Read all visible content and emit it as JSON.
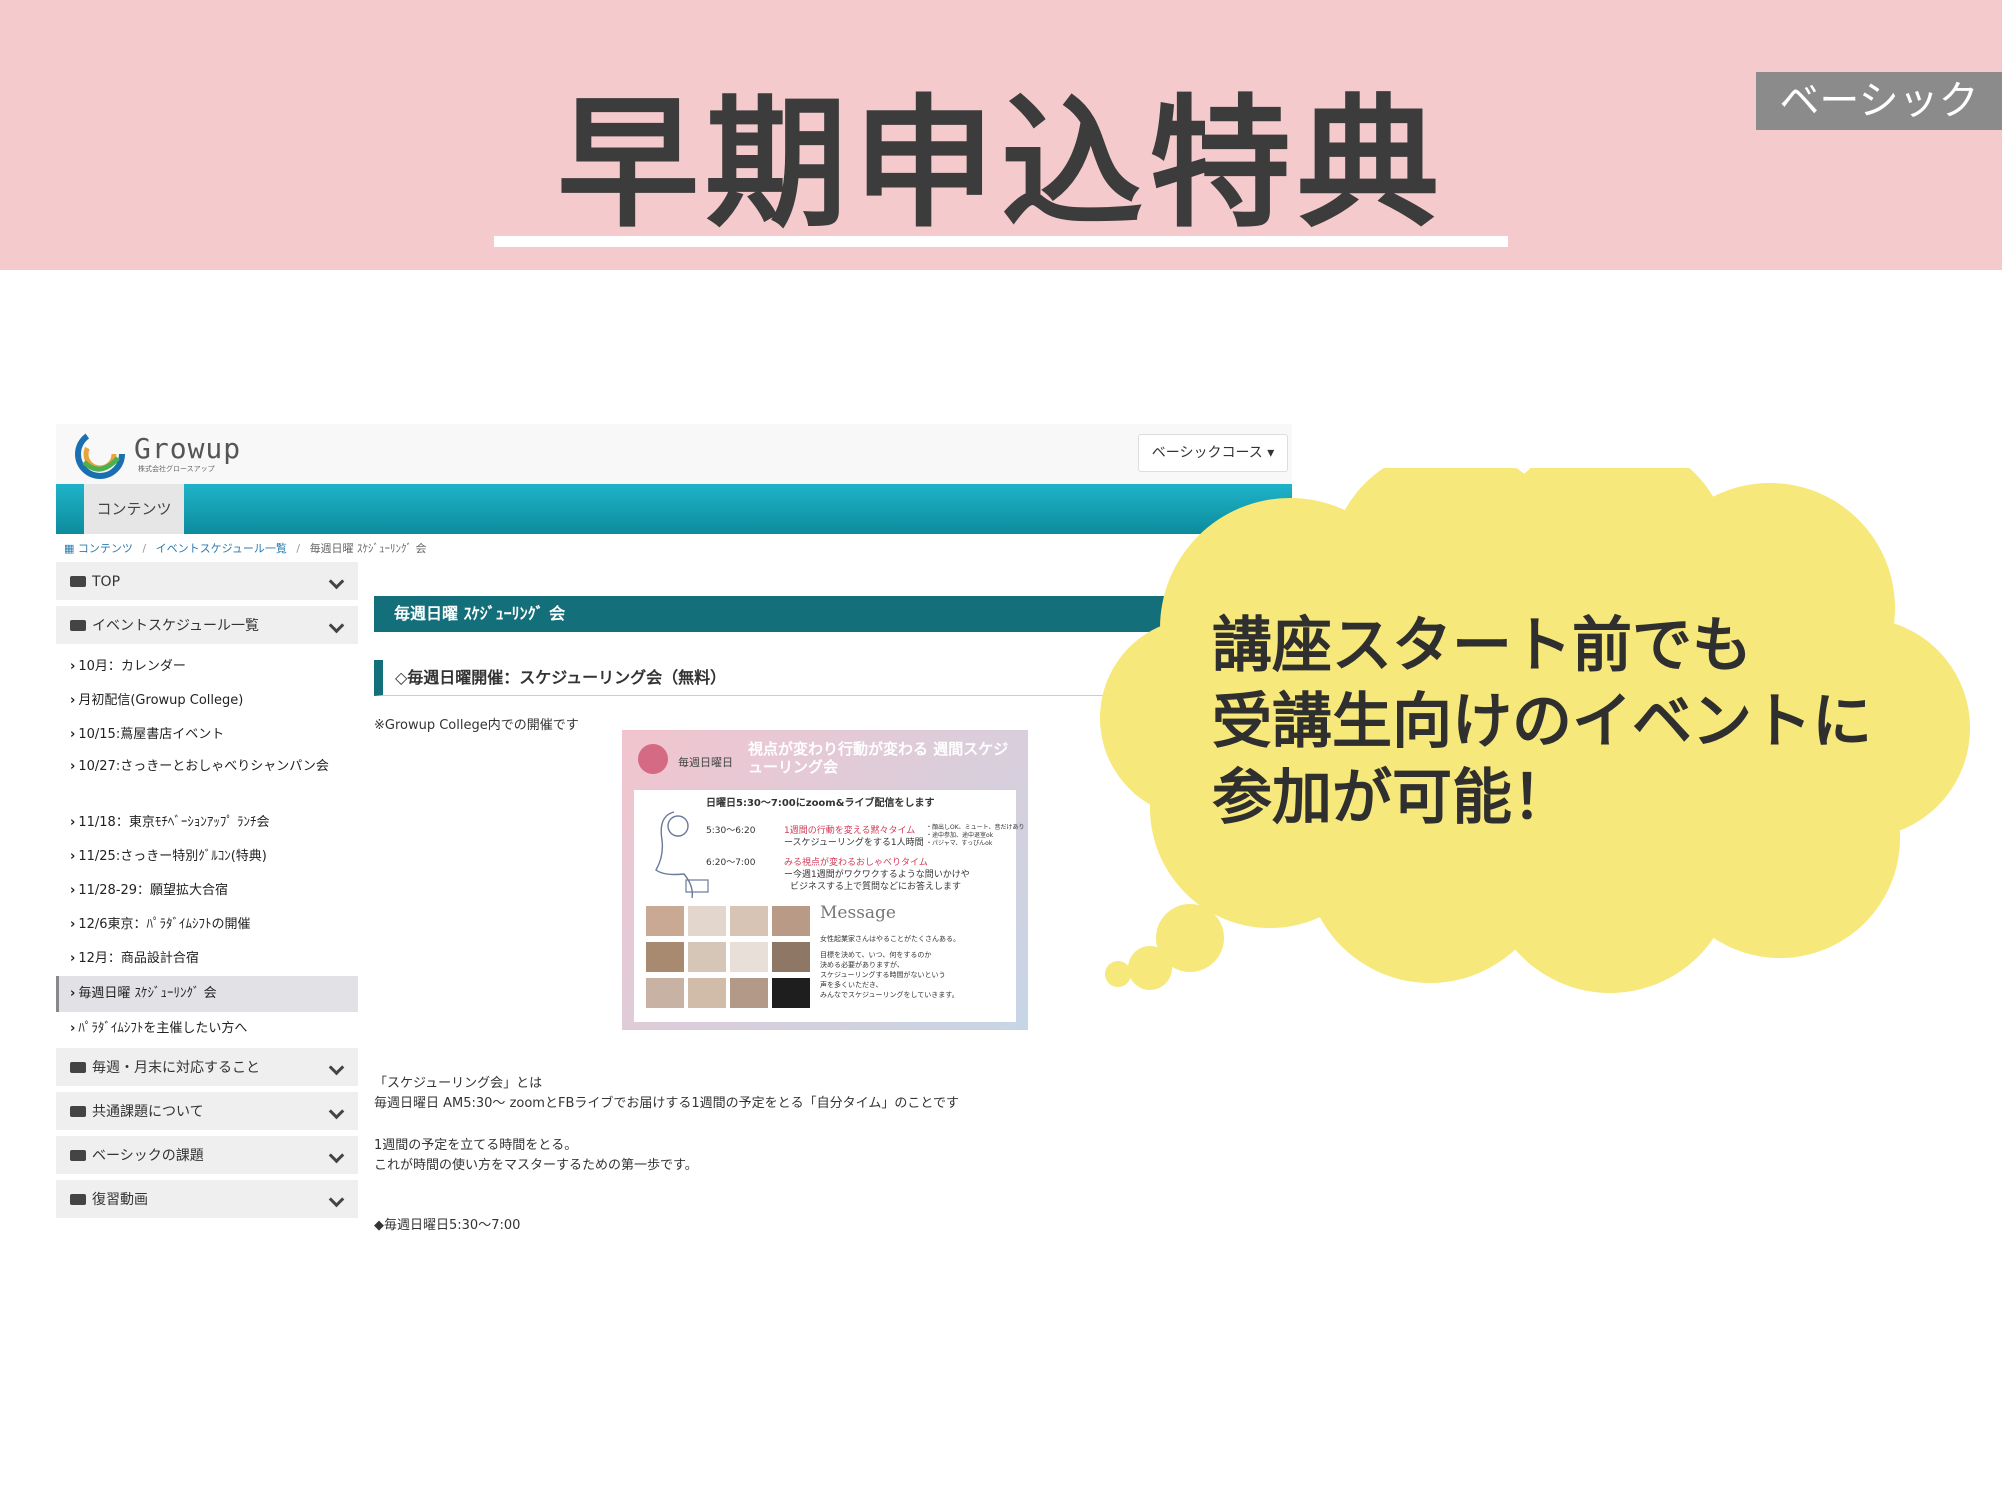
{
  "slide": {
    "title": "早期申込特典",
    "course_tag": "ベーシック",
    "callout_lines": [
      "講座スタート前でも",
      "受講生向けのイベントに",
      "参加が可能！"
    ],
    "colors": {
      "banner": "#f4cacd",
      "cloud": "#f6e87a",
      "teal": "#136f79"
    }
  },
  "screenshot": {
    "logo_text": "Growup",
    "logo_sub": "株式会社グロースアップ",
    "course_select": "ベーシックコース",
    "nav_tab": "コンテンツ",
    "breadcrumb": [
      "コンテンツ",
      "イベントスケジュール一覧",
      "毎週日曜 ｽｹｼﾞｭｰﾘﾝｸﾞ 会"
    ],
    "sidebar": {
      "top": "TOP",
      "events": "イベントスケジュール一覧",
      "event_items": [
        "10月：カレンダー",
        "月初配信(Growup College)",
        "10/15:蔦屋書店イベント",
        "10/27:さっきーとおしゃべりシャンパン会",
        "11/18：東京ﾓﾁﾍﾞｰｼｮﾝｱｯﾌﾟ ﾗﾝﾁ会",
        "11/25:さっきー特別ｸﾞﾙｺﾝ(特典)",
        "11/28-29：願望拡大合宿",
        "12/6東京：ﾊﾟﾗﾀﾞｲﾑｼﾌﾄの開催",
        "12月：商品設計合宿",
        "毎週日曜 ｽｹｼﾞｭｰﾘﾝｸﾞ 会",
        "ﾊﾟﾗﾀﾞｲﾑｼﾌﾄを主催したい方へ"
      ],
      "sections": [
        "毎週・月末に対応すること",
        "共通課題について",
        "ベーシックの課題",
        "復習動画"
      ]
    },
    "content": {
      "panel_title": "毎週日曜 ｽｹｼﾞｭｰﾘﾝｸﾞ 会",
      "section_head": "◇毎週日曜開催：スケジューリング会（無料）",
      "note": "※Growup College内での開催です",
      "flyer": {
        "day": "毎週日曜日",
        "headline": "視点が変わり行動が変わる 週間スケジューリング会",
        "time_line": "日曜日5:30〜7:00にzoom&ライブ配信をします",
        "slot1_time": "5:30〜6:20",
        "slot1_title": "1週間の行動を変える黙々タイム",
        "slot1_desc": "ースケジューリングをする1人時間",
        "slot2_time": "6:20〜7:00",
        "slot2_title": "みる視点が変わるおしゃべりタイム",
        "slot2_desc1": "ー今週1週間がワクワクするような問いかけや",
        "slot2_desc2": "ビジネスする上で質問などにお答えします",
        "side_note1": "・顔出しOK、ミュート、音だけあり",
        "side_note2": "・途中参加、途中退室ok",
        "side_note3": "・パジャマ、すっぴんok",
        "message_title": "Message",
        "message_lines": [
          "女性起業家さんはやることがたくさんある。",
          "目標を決めて、いつ、何をするのか",
          "決める必要がありますが、",
          "スケジューリングする時間がないという",
          "声を多くいただき、",
          "みんなでスケジューリングをしていきます。"
        ]
      },
      "paragraphs": [
        "「スケジューリング会」とは",
        "毎週日曜日 AM5:30〜 zoomとFBライブでお届けする1週間の予定をとる「自分タイム」のことです",
        "1週間の予定を立てる時間をとる。",
        "これが時間の使い方をマスターするための第一歩です。",
        "◆毎週日曜日5:30〜7:00"
      ]
    }
  }
}
